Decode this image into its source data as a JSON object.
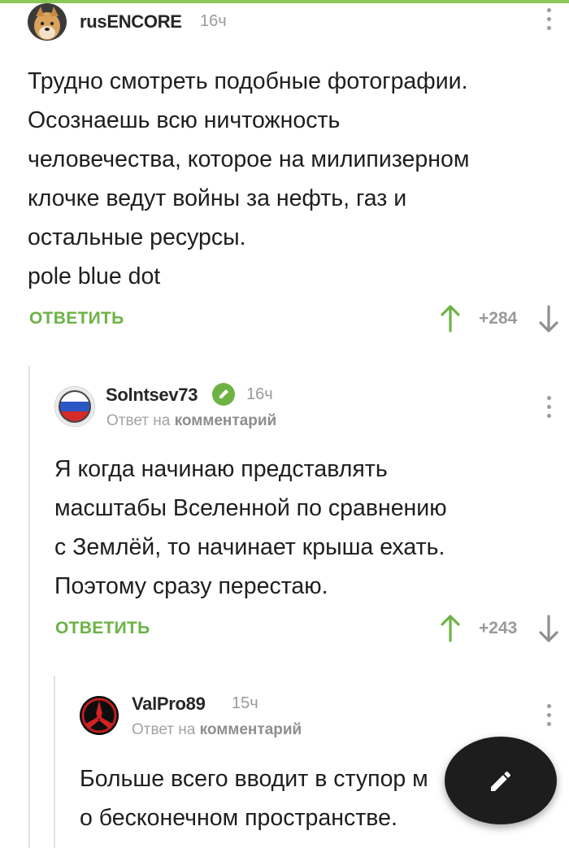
{
  "colors": {
    "accent": "#6cb344",
    "topbar": "#8ac858",
    "fab": "#1d1d1d"
  },
  "comments": [
    {
      "username": "rusENCORE",
      "time": "16ч",
      "text": "Трудно смотреть подобные фотографии.\nОсознаешь всю ничтожность\nчеловечества, которое на милипизерном\nклочке ведут войны за нефть, газ и\nостальные ресурсы.\npole blue dot",
      "reply_label": "ОТВЕТИТЬ",
      "rating": "+284",
      "avatar_icon": "dog-avatar"
    },
    {
      "username": "Solntsev73",
      "verified_icon": "pencil-check-icon",
      "time": "16ч",
      "reply_to_prefix": "Ответ на",
      "reply_to_link": "комментарий",
      "text": "Я когда начинаю представлять\nмасштабы Вселенной по сравнению\nс Землёй, то начинает крыша ехать.\nПоэтому сразу перестаю.",
      "reply_label": "ОТВЕТИТЬ",
      "rating": "+243",
      "avatar_icon": "russian-flag-avatar"
    },
    {
      "username": "ValPro89",
      "time": "15ч",
      "reply_to_prefix": "Ответ на",
      "reply_to_link": "комментарий",
      "text": "Больше всего вводит в ступор м\nо бесконечном пространстве.",
      "avatar_icon": "red-emblem-avatar"
    }
  ],
  "fab": {
    "icon": "pencil-icon"
  }
}
